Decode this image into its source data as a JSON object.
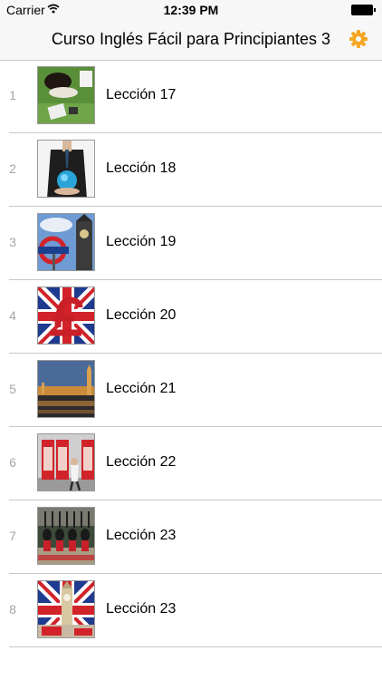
{
  "status_bar": {
    "carrier": "Carrier",
    "time": "12:39 PM"
  },
  "nav": {
    "title": "Curso Inglés Fácil para Principiantes 3",
    "settings_icon": "gear-icon",
    "accent_color": "#f5a623"
  },
  "lessons": [
    {
      "number": "1",
      "label": "Lección 17",
      "thumbnail": "woman-on-grass-image"
    },
    {
      "number": "2",
      "label": "Lección 18",
      "thumbnail": "businessman-globe-image"
    },
    {
      "number": "3",
      "label": "Lección 19",
      "thumbnail": "underground-sign-big-ben-image"
    },
    {
      "number": "4",
      "label": "Lección 20",
      "thumbnail": "pound-sign-union-jack-image"
    },
    {
      "number": "5",
      "label": "Lección 21",
      "thumbnail": "westminster-night-image"
    },
    {
      "number": "6",
      "label": "Lección 22",
      "thumbnail": "red-phone-boxes-image"
    },
    {
      "number": "7",
      "label": "Lección 23",
      "thumbnail": "royal-guards-image"
    },
    {
      "number": "8",
      "label": "Lección 23",
      "thumbnail": "big-ben-union-jack-image"
    }
  ]
}
